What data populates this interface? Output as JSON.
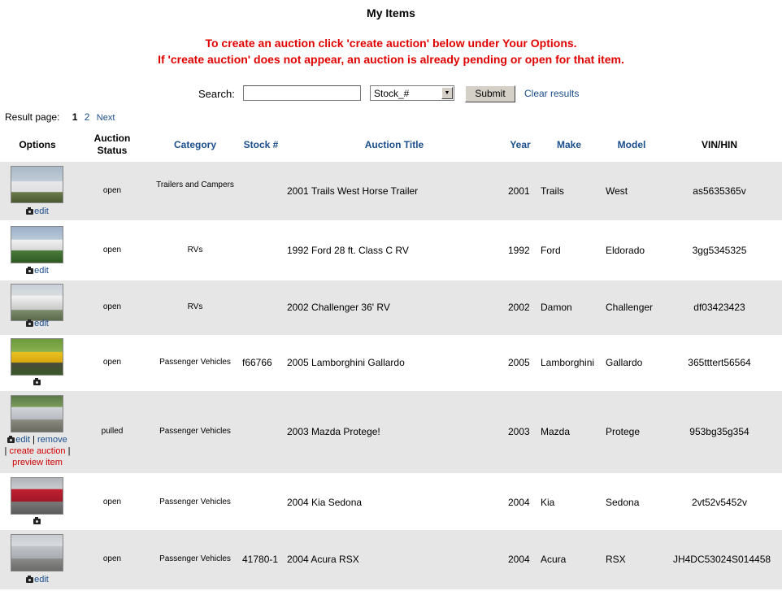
{
  "page": {
    "title": "My Items",
    "notice_line1": "To create an auction click 'create auction' below under Your Options.",
    "notice_line2": "If 'create auction' does not appear, an auction is already pending or open for that item."
  },
  "search": {
    "label": "Search:",
    "input_value": "",
    "select_value": "Stock_#",
    "submit_label": "Submit",
    "clear_label": "Clear results"
  },
  "pager": {
    "label": "Result page:",
    "current": "1",
    "page2": "2",
    "next": "Next"
  },
  "columns": {
    "options": "Options",
    "auction_status": "Auction Status",
    "category": "Category",
    "stock": "Stock #",
    "auction_title": "Auction Title",
    "year": "Year",
    "make": "Make",
    "model": "Model",
    "vin": "VIN/HIN"
  },
  "rows": [
    {
      "status": "open",
      "category": "Trailers and Campers",
      "stock": "",
      "title": "2001 Trails West Horse Trailer",
      "year": "2001",
      "make": "Trails",
      "model": "West",
      "vin": "as5635365v",
      "edit": "edit",
      "remove": "",
      "create": "",
      "preview": ""
    },
    {
      "status": "open",
      "category": "RVs",
      "stock": "",
      "title": "1992 Ford 28 ft. Class C RV",
      "year": "1992",
      "make": "Ford",
      "model": "Eldorado",
      "vin": "3gg5345325",
      "edit": "edit",
      "remove": "",
      "create": "",
      "preview": ""
    },
    {
      "status": "open",
      "category": "RVs",
      "stock": "",
      "title": "2002 Challenger 36' RV",
      "year": "2002",
      "make": "Damon",
      "model": "Challenger",
      "vin": "df03423423",
      "edit": "edit",
      "remove": "",
      "create": "",
      "preview": ""
    },
    {
      "status": "open",
      "category": "Passenger Vehicles",
      "stock": "f66766",
      "title": "2005 Lamborghini Gallardo",
      "year": "2005",
      "make": "Lamborghini",
      "model": "Gallardo",
      "vin": "365tttert56564",
      "edit": "",
      "remove": "",
      "create": "",
      "preview": ""
    },
    {
      "status": "pulled",
      "category": "Passenger Vehicles",
      "stock": "",
      "title": "2003 Mazda Protege!",
      "year": "2003",
      "make": "Mazda",
      "model": "Protege",
      "vin": "953bg35g354",
      "edit": "edit",
      "remove": "remove",
      "create": "create auction",
      "preview": "preview item"
    },
    {
      "status": "open",
      "category": "Passenger Vehicles",
      "stock": "",
      "title": "2004 Kia Sedona",
      "year": "2004",
      "make": "Kia",
      "model": "Sedona",
      "vin": "2vt52v5452v",
      "edit": "",
      "remove": "",
      "create": "",
      "preview": ""
    },
    {
      "status": "open",
      "category": "Passenger Vehicles",
      "stock": "41780-1",
      "title": "2004 Acura RSX",
      "year": "2004",
      "make": "Acura",
      "model": "RSX",
      "vin": "JH4DC53024S014458",
      "edit": "edit",
      "remove": "",
      "create": "",
      "preview": ""
    }
  ],
  "colors": {
    "notice": "#e00000",
    "link": "#1a4e8c",
    "row_shade": "#e6e6e6"
  },
  "icons": {
    "photo": "camera-icon",
    "dropdown": "dropdown-arrow-icon"
  }
}
